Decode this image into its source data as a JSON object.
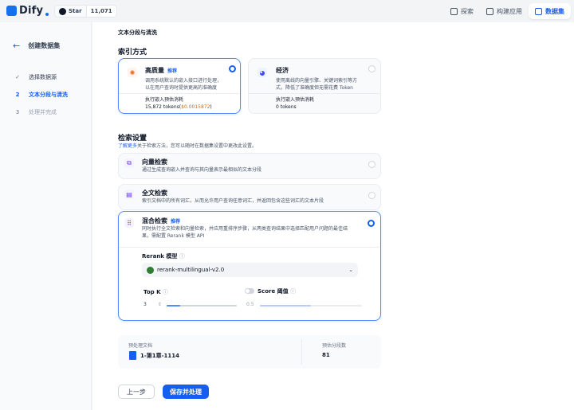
{
  "app": {
    "name": "Dify"
  },
  "github": {
    "label": "Star",
    "count": "11,071"
  },
  "nav": {
    "explore": "探索",
    "build": "构建应用",
    "datasets": "数据集"
  },
  "sidebar": {
    "title": "创建数据集",
    "steps": [
      {
        "num": "✓",
        "label": "选择数据源"
      },
      {
        "num": "2",
        "label": "文本分段与清洗"
      },
      {
        "num": "3",
        "label": "处理并完成"
      }
    ]
  },
  "main": {
    "section_head": "文本分段与清洗",
    "index_heading": "索引方式",
    "high_quality": {
      "title": "高质量",
      "badge": "推荐",
      "desc1": "调用系统默认的嵌入接口进行处理，",
      "desc2": "以在用户查询时提供更高的准确度",
      "meta_label": "执行嵌入预估消耗",
      "tokens": "15,872 tokens(",
      "price": "$0.0015872",
      "close": ")"
    },
    "economy": {
      "title": "经济",
      "desc1": "使用离线的向量引擎、关键词索引等方",
      "desc2": "式，降低了准确度但无需花费 Token",
      "meta_label": "执行嵌入预估消耗",
      "tokens": "0 tokens"
    },
    "retrieval_heading": "检索设置",
    "retrieval_sub_link": "了解更多",
    "retrieval_sub": "关于检索方法，您可以随时在数据集设置中更改此设置。",
    "vector": {
      "title": "向量检索",
      "desc": "通过生成查询嵌入并查询与其向量表示最相似的文本分段"
    },
    "fulltext": {
      "title": "全文检索",
      "desc": "索引文档中的所有词汇，从而允许用户查询任意词汇，并返回包含这些词汇的文本片段"
    },
    "hybrid": {
      "title": "混合检索",
      "badge": "推荐",
      "desc1": "同时执行全文检索和向量检索，并应用重排序步骤，从两类查询结果中选择匹配用户问题的最佳结",
      "desc2": "果，需配置 Rerank 模型 API",
      "rerank_label": "Rerank 模型",
      "rerank_model": "rerank-multilingual-v2.0",
      "topk_label": "Top K",
      "topk_value": "3",
      "score_label": "Score 阈值",
      "score_value": "0.5"
    },
    "preview": {
      "doc_label": "预处理文档",
      "doc_name": "1-第1章-1114",
      "seg_label": "预估分段数",
      "seg_value": "81"
    },
    "buttons": {
      "prev": "上一步",
      "save": "保存并处理"
    }
  },
  "colors": {
    "primary": "#155eef",
    "price": "#dc6803"
  }
}
